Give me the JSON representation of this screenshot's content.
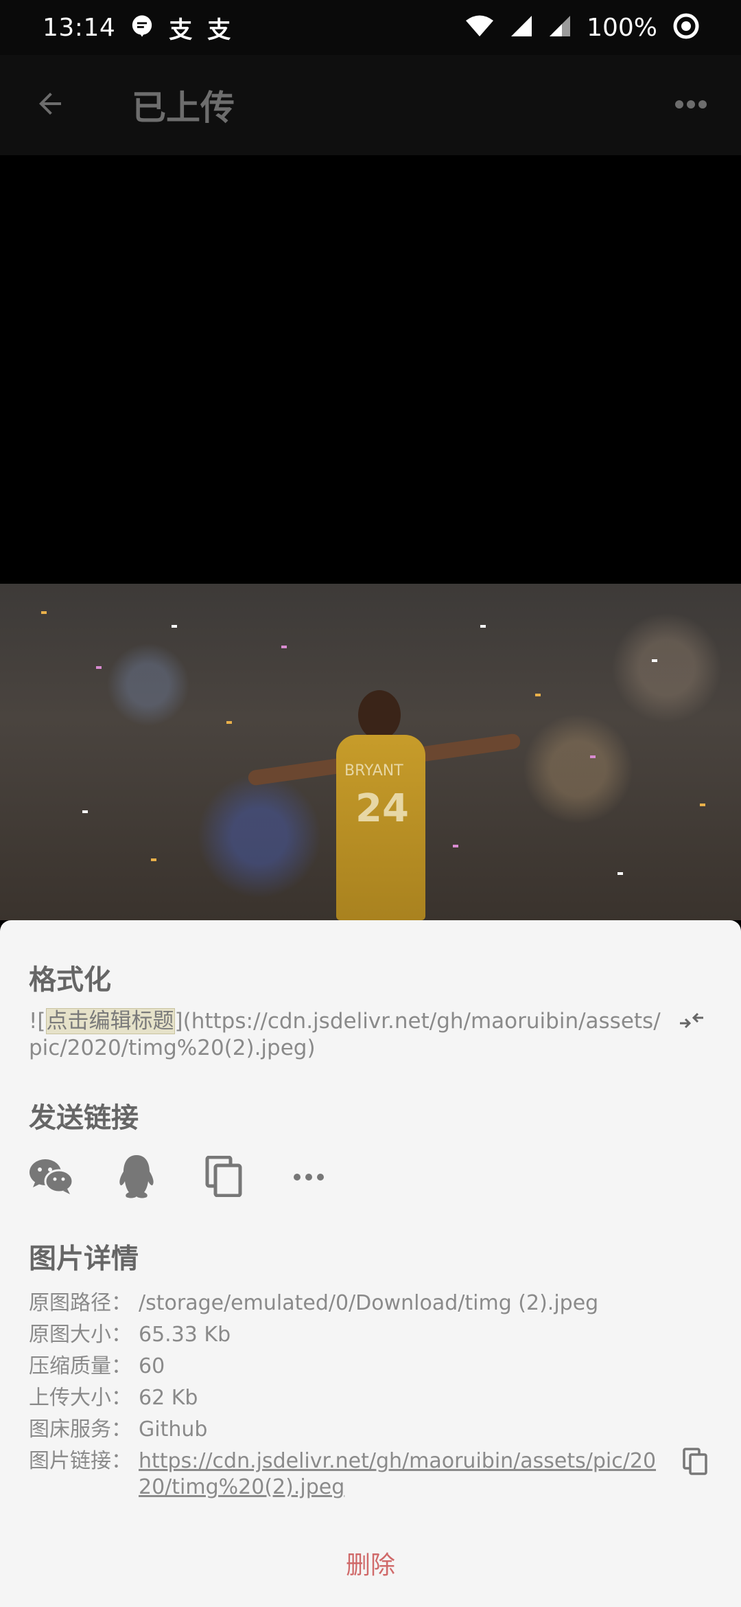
{
  "status_bar": {
    "time": "13:14",
    "notif_glyphs": [
      "支",
      "支"
    ],
    "battery": "100%"
  },
  "app_bar": {
    "title": "已上传"
  },
  "photo": {
    "jersey_name": "BRYANT",
    "jersey_number": "24"
  },
  "format": {
    "title": "格式化",
    "prefix": "![",
    "highlight": "点击编辑标题",
    "suffix": "](https://cdn.jsdelivr.net/gh/maoruibin/assets/pic/2020/timg%20(2).jpeg)"
  },
  "share": {
    "title": "发送链接",
    "buttons": [
      "wechat-icon",
      "qq-icon",
      "copy-icon",
      "more-icon"
    ]
  },
  "details": {
    "title": "图片详情",
    "rows": [
      {
        "label": "原图路径：",
        "value": "/storage/emulated/0/Download/timg (2).jpeg"
      },
      {
        "label": "原图大小：",
        "value": "65.33 Kb"
      },
      {
        "label": "压缩质量：",
        "value": "60"
      },
      {
        "label": "上传大小：",
        "value": "62 Kb"
      },
      {
        "label": "图床服务：",
        "value": "Github"
      }
    ],
    "link_label": "图片链接：",
    "link_value": "https://cdn.jsdelivr.net/gh/maoruibin/assets/pic/2020/timg%20(2).jpeg"
  },
  "delete_label": "删除"
}
